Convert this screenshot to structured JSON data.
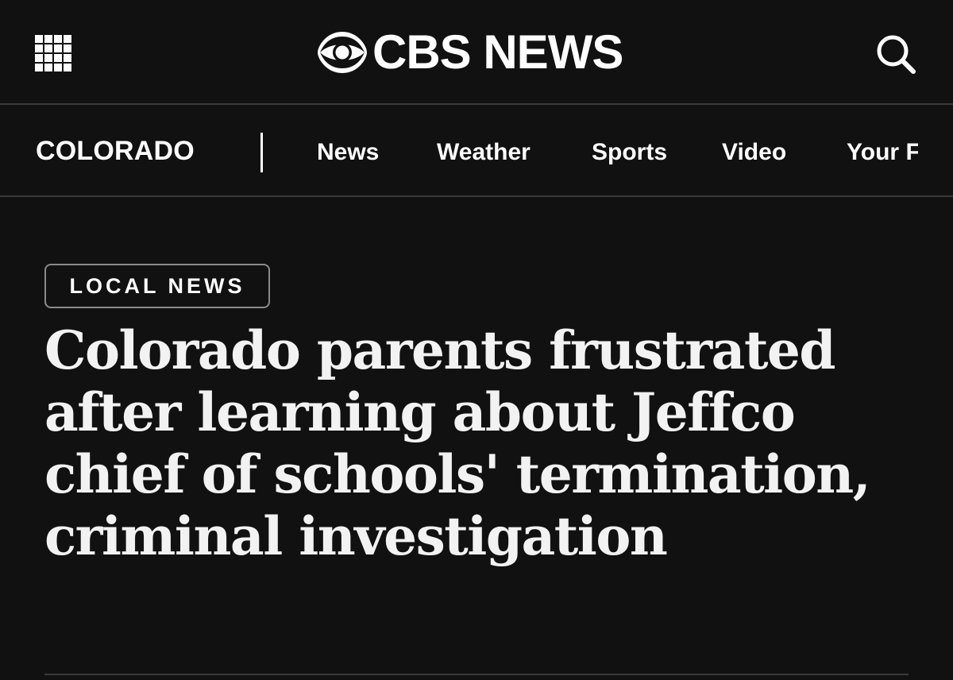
{
  "header": {
    "menu_icon": "grid-menu-icon",
    "logo": {
      "icon": "cbs-eye-icon",
      "text": "CBS NEWS"
    },
    "search_icon": "search-icon"
  },
  "nav": {
    "section": "COLORADO",
    "items": [
      "News",
      "Weather",
      "Sports",
      "Video",
      "Your F"
    ]
  },
  "article": {
    "category": "LOCAL NEWS",
    "headline": "Colorado parents frustrated after learning about Jeffco chief of schools' termination, criminal investigation"
  },
  "colors": {
    "background": "#111111",
    "text": "#ffffff",
    "divider": "#3a3a3a",
    "badge_border": "#8a8a8a"
  }
}
